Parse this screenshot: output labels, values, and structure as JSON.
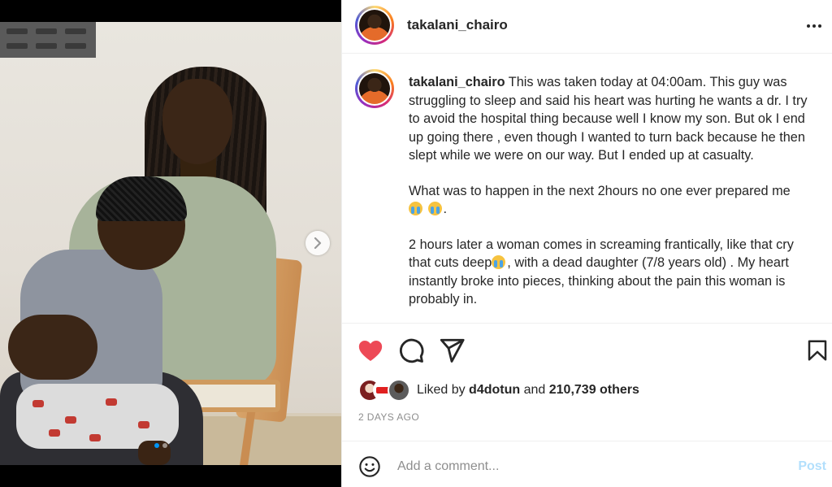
{
  "post": {
    "author": "takalani_chairo",
    "more_icon": "more-horizontal-icon"
  },
  "caption": {
    "username": "takalani_chairo",
    "para1": "This was taken today at 04:00am. This guy was struggling to sleep and said his heart was hurting he wants a dr. I try to avoid the hospital thing because well I know my son. But ok I end up going there , even though I wanted to turn back because he then slept while we were on our way. But I ended up at casualty.",
    "para2": "What was to happen in the next 2hours no one ever prepared me",
    "para2_end": ".",
    "para3_a": "2 hours later a woman comes in screaming frantically, like that cry that cuts deep",
    "para3_b": ", with a dead daughter (7/8 years old) . My heart instantly broke into pieces, thinking about the pain this woman is probably in."
  },
  "media": {
    "next_icon": "chevron-right-icon",
    "slide_count": 2,
    "active_slide": 1
  },
  "actions": {
    "like_icon": "heart-filled-icon",
    "comment_icon": "comment-icon",
    "share_icon": "send-icon",
    "save_icon": "bookmark-icon",
    "like_color": "#ed4956"
  },
  "likes": {
    "prefix": "Liked by",
    "user": "d4dotun",
    "middle": "and",
    "count": "210,739 others"
  },
  "timestamp": "2 DAYS AGO",
  "comment": {
    "placeholder": "Add a comment...",
    "post_label": "Post",
    "emoji_icon": "smiley-icon"
  },
  "colors": {
    "post_button_disabled": "#b2dffc",
    "active_dot": "#0095f6"
  }
}
